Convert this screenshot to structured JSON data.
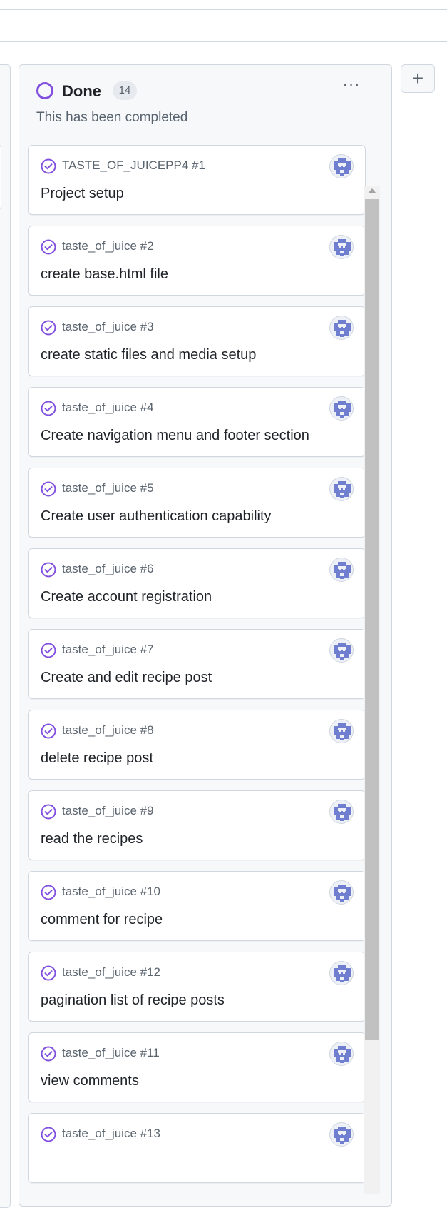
{
  "column": {
    "title": "Done",
    "count": "14",
    "description": "This has been completed",
    "more_label": "···",
    "status_color": "#8250df"
  },
  "add_column_label": "+",
  "icons": {
    "status": "done-circle-icon",
    "card_status": "check-circle-icon",
    "avatar": "identicon-avatar-icon",
    "more": "kebab-horizontal-icon",
    "add": "plus-icon"
  },
  "cards": [
    {
      "ref": "TASTE_OF_JUICEPP4 #1",
      "title": "Project setup"
    },
    {
      "ref": "taste_of_juice #2",
      "title": "create base.html file"
    },
    {
      "ref": "taste_of_juice #3",
      "title": "create static files and media setup"
    },
    {
      "ref": "taste_of_juice #4",
      "title": "Create navigation menu and footer section"
    },
    {
      "ref": "taste_of_juice #5",
      "title": "Create user authentication capability"
    },
    {
      "ref": "taste_of_juice #6",
      "title": "Create account registration"
    },
    {
      "ref": "taste_of_juice #7",
      "title": "Create and edit recipe post"
    },
    {
      "ref": "taste_of_juice #8",
      "title": "delete recipe post"
    },
    {
      "ref": "taste_of_juice #9",
      "title": "read the recipes"
    },
    {
      "ref": "taste_of_juice #10",
      "title": "comment for recipe"
    },
    {
      "ref": "taste_of_juice #12",
      "title": "pagination list of recipe posts"
    },
    {
      "ref": "taste_of_juice #11",
      "title": "view comments"
    },
    {
      "ref": "taste_of_juice #13",
      "title": ""
    }
  ]
}
